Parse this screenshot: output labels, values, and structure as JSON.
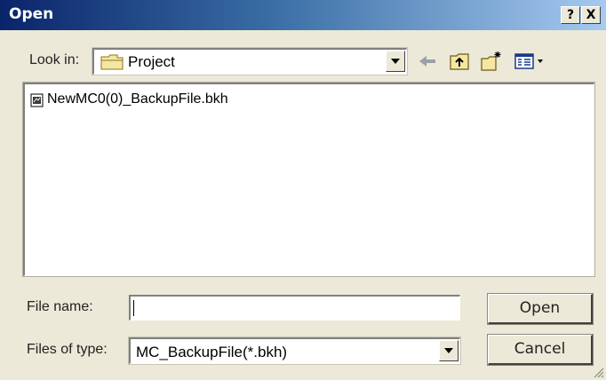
{
  "window": {
    "title": "Open",
    "help_glyph": "?",
    "close_glyph": "X"
  },
  "look_in": {
    "label": "Look in:",
    "value": "Project",
    "icon": "folder-icon"
  },
  "toolbar": {
    "icons": [
      "back-arrow-icon",
      "up-one-level-icon",
      "new-folder-icon",
      "view-menu-icon"
    ]
  },
  "files": [
    {
      "name": "NewMC0(0)_BackupFile.bkh",
      "icon": "backup-file-icon"
    }
  ],
  "file_name": {
    "label": "File name:",
    "value": ""
  },
  "file_type": {
    "label": "Files of type:",
    "value": "MC_BackupFile(*.bkh)"
  },
  "buttons": {
    "open": "Open",
    "cancel": "Cancel"
  },
  "colors": {
    "title_bar_start": "#0a246a",
    "title_bar_end": "#a6caf0",
    "dialog_bg": "#ece9d8"
  }
}
